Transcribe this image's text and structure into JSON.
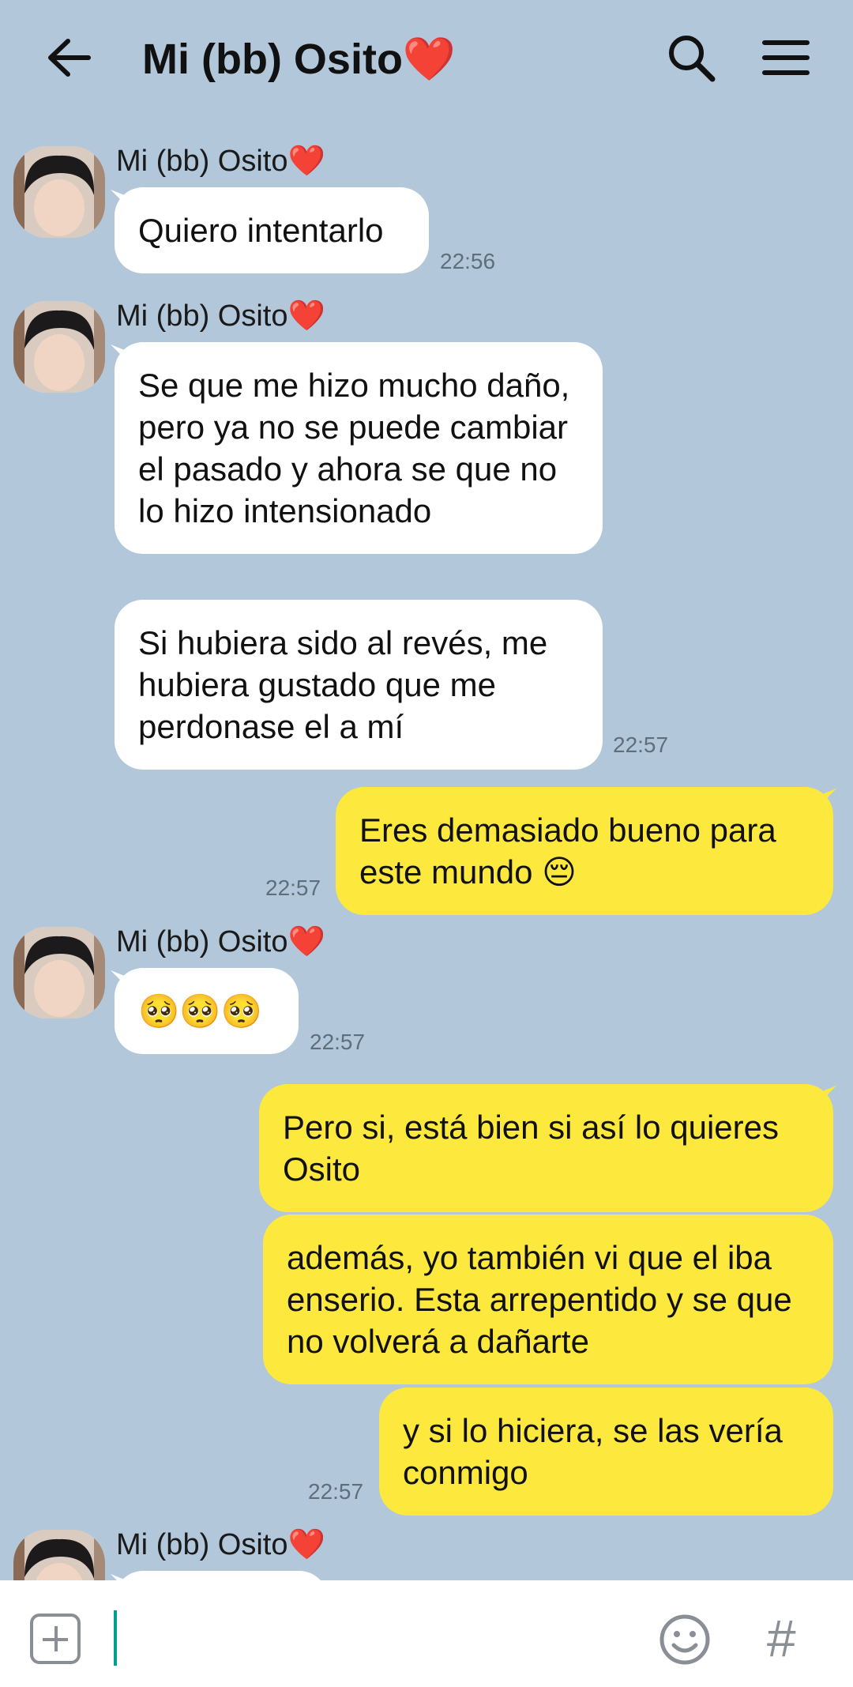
{
  "header": {
    "title": "Mi (bb) Osito❤️",
    "back_icon": "arrow-left-icon",
    "search_icon": "search-icon",
    "menu_icon": "menu-icon"
  },
  "messages": [
    {
      "direction": "in",
      "sender": "Mi (bb) Osito❤️",
      "text": "Quiero intentarlo",
      "time": "22:56"
    },
    {
      "direction": "in",
      "sender": "Mi (bb) Osito❤️",
      "text": "Se que me hizo mucho daño, pero ya no se puede cambiar el pasado y ahora se que no lo hizo intensionado"
    },
    {
      "direction": "in",
      "text": "Si hubiera sido al revés, me hubiera gustado que me perdonase el a mí",
      "time": "22:57"
    },
    {
      "direction": "out",
      "text": "Eres demasiado bueno para este mundo 😔",
      "time": "22:57"
    },
    {
      "direction": "in",
      "sender": "Mi (bb) Osito❤️",
      "text": "🥺🥺🥺",
      "time": "22:57"
    },
    {
      "direction": "out",
      "text": "Pero si, está bien si así lo quieres Osito"
    },
    {
      "direction": "out",
      "text": "además, yo también vi que el iba enserio. Esta arrepentido y se que no volverá a dañarte"
    },
    {
      "direction": "out",
      "text": "y si lo hiciera, se las vería conmigo",
      "time": "22:57"
    },
    {
      "direction": "in",
      "sender": "Mi (bb) Osito❤️",
      "text": ""
    }
  ],
  "input_bar": {
    "plus_icon": "plus-square-icon",
    "placeholder": "",
    "emoji_icon": "emoji-icon",
    "hash_label": "#"
  },
  "colors": {
    "background": "#b2c7da",
    "incoming_bubble": "#ffffff",
    "outgoing_bubble": "#fde93d",
    "caret": "#00a08a"
  }
}
